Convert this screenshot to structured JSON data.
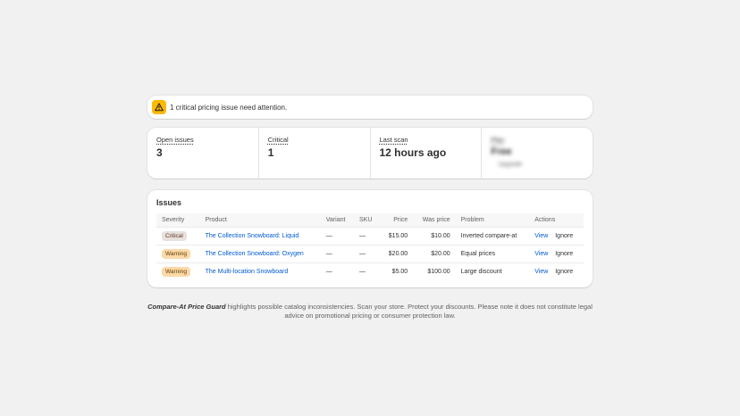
{
  "banner": {
    "icon": "warning-icon",
    "accent": "#ffb800",
    "text": "1 critical pricing issue need attention."
  },
  "stats": [
    {
      "label": "Open issues",
      "value": "3"
    },
    {
      "label": "Critical",
      "value": "1"
    },
    {
      "label": "Last scan",
      "value": "12 hours ago"
    },
    {
      "label": "Plan",
      "value": "Free",
      "sub": "Upgrade"
    }
  ],
  "issues": {
    "title": "Issues",
    "columns": [
      "Severity",
      "Product",
      "Variant",
      "SKU",
      "Price",
      "Was price",
      "Problem",
      "Actions"
    ],
    "rows": [
      {
        "severity": "Critical",
        "product": "The Collection Snowboard: Liquid",
        "variant": "—",
        "sku": "—",
        "price": "$15.00",
        "was_price": "$10.00",
        "problem": "Inverted compare-at",
        "view": "View",
        "ignore": "Ignore"
      },
      {
        "severity": "Warning",
        "product": "The Collection Snowboard: Oxygen",
        "variant": "—",
        "sku": "—",
        "price": "$20.00",
        "was_price": "$20.00",
        "problem": "Equal prices",
        "view": "View",
        "ignore": "Ignore"
      },
      {
        "severity": "Warning",
        "product": "The Multi-location Snowboard",
        "variant": "—",
        "sku": "—",
        "price": "$5.00",
        "was_price": "$100.00",
        "problem": "Large discount",
        "view": "View",
        "ignore": "Ignore"
      }
    ]
  },
  "footer": {
    "app_name": "Compare-At Price Guard",
    "text": " highlights possible catalog inconsistencies. Scan your store. Protect your discounts. Please note it does not constitute legal advice on promotional pricing or consumer protection law."
  },
  "colors": {
    "link": "#005bd3",
    "critical_badge": "#e8e0dc",
    "warning_badge": "#fcd9a8"
  }
}
